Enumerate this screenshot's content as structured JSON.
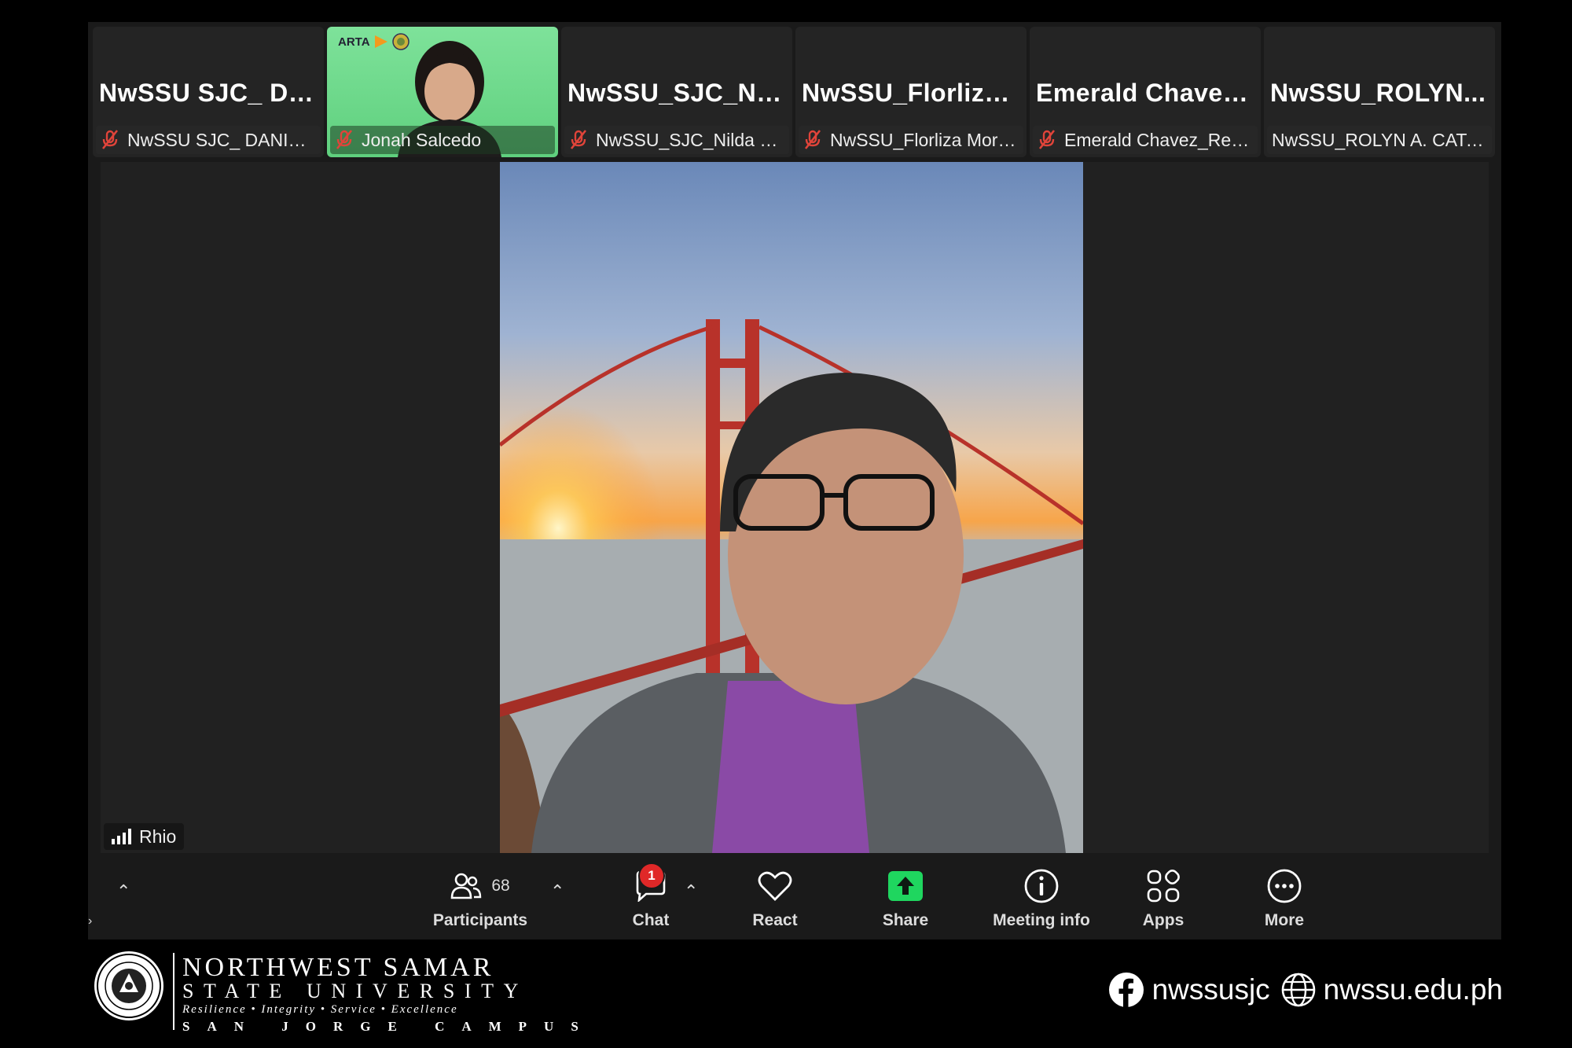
{
  "participants": [
    {
      "display": "NwSSU SJC_ DA...",
      "name": "NwSSU SJC_ DANICA ...",
      "muted": true,
      "video": false
    },
    {
      "display": "",
      "name": "Jonah Salcedo",
      "muted": true,
      "video": true,
      "overlay_logo": "ARTA"
    },
    {
      "display": "NwSSU_SJC_Nil...",
      "name": "NwSSU_SJC_Nilda C. J...",
      "muted": true,
      "video": false
    },
    {
      "display": "NwSSU_Florliza...",
      "name": "NwSSU_Florliza Morilao",
      "muted": true,
      "video": false
    },
    {
      "display": "Emerald  Chavez...",
      "name": "Emerald Chavez_Recor...",
      "muted": true,
      "video": false
    },
    {
      "display": "NwSSU_ROLYN...",
      "name": "NwSSU_ROLYN A. CATAM...",
      "muted": false,
      "video": false
    }
  ],
  "speaker": {
    "name": "Rhio"
  },
  "toolbar": {
    "participants_label": "Participants",
    "participants_count": "68",
    "chat_label": "Chat",
    "chat_badge": "1",
    "react_label": "React",
    "share_label": "Share",
    "meeting_info_label": "Meeting info",
    "apps_label": "Apps",
    "more_label": "More"
  },
  "branding": {
    "line1": "NORTHWEST SAMAR",
    "line2": "STATE UNIVERSITY",
    "motto": "Resilience • Integrity • Service • Excellence",
    "campus": "SAN JORGE CAMPUS",
    "facebook": "nwssusjc",
    "website": "nwssu.edu.ph"
  },
  "colors": {
    "share_green": "#1fd65f",
    "badge_red": "#e02828",
    "mute_red": "#e0443a"
  }
}
